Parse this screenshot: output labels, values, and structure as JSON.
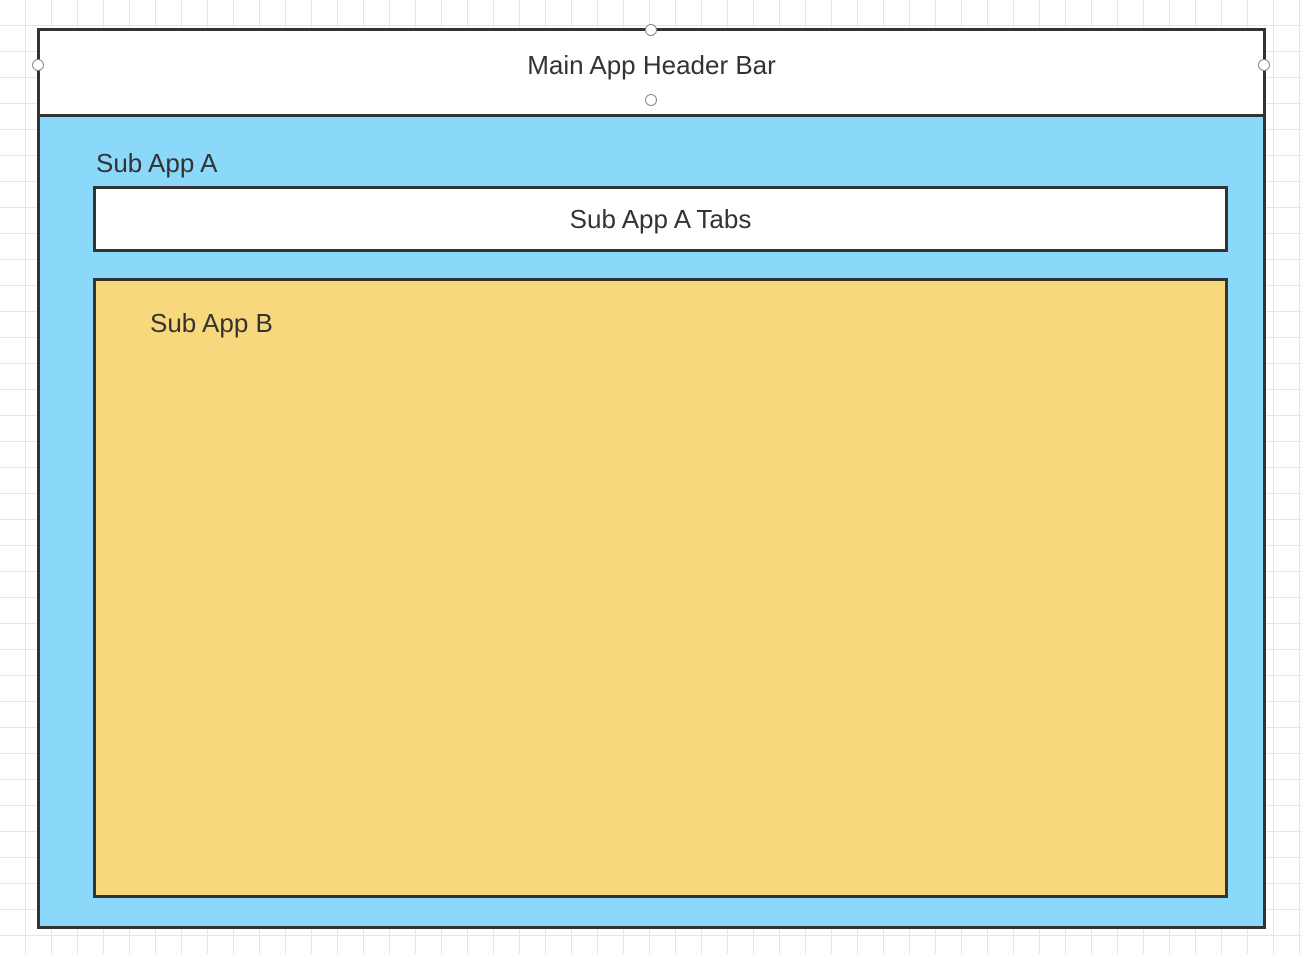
{
  "diagram": {
    "main_header": {
      "label": "Main App Header Bar",
      "fill_color": "#ffffff"
    },
    "sub_app_a": {
      "label": "Sub App A",
      "fill_color": "#8bd9fa",
      "tabs": {
        "label": "Sub App A Tabs",
        "fill_color": "#ffffff"
      }
    },
    "sub_app_b": {
      "label": "Sub App B",
      "fill_color": "#f8d87c"
    },
    "border_color": "#333333"
  }
}
